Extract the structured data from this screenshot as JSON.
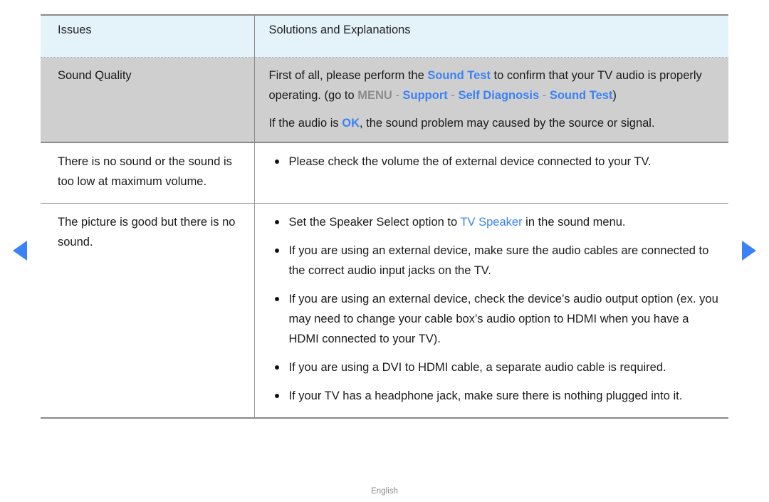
{
  "nav": {
    "prev_label": "previous page",
    "next_label": "next page"
  },
  "table": {
    "headers": {
      "issues": "Issues",
      "solutions": "Solutions and Explanations"
    },
    "rows": [
      {
        "issue": "Sound Quality",
        "highlighted": true,
        "paragraph_1": {
          "seg_1": "First of all, please perform the ",
          "kw_1": "Sound Test",
          "seg_2": " to confirm that your TV audio is properly operating. (go to ",
          "kw_menu": "MENU",
          "sep_1": " - ",
          "kw_support": "Support",
          "sep_2": " - ",
          "kw_selfdiag": "Self Diagnosis",
          "sep_3": " - ",
          "kw_soundtest": "Sound Test",
          "seg_end": ")"
        },
        "paragraph_2": {
          "seg_1": "If the audio is ",
          "kw_ok": "OK",
          "seg_2": ", the sound problem may caused by the source or signal."
        }
      },
      {
        "issue": "There is no sound or the sound is too low at maximum volume.",
        "highlighted": false,
        "bullets": [
          {
            "seg_1": "Please check the volume the of external device connected to your TV."
          }
        ]
      },
      {
        "issue": "The picture is good but there is no sound.",
        "highlighted": false,
        "bullets": [
          {
            "seg_1": "Set the Speaker Select option to ",
            "kw": "TV Speaker",
            "seg_2": " in the sound menu."
          },
          {
            "seg_1": "If you are using an external device, make sure the audio cables are connected to the correct audio input jacks on the TV."
          },
          {
            "seg_1": "If you are using an external device, check the device’s audio output option (ex. you may need to change your cable box’s audio option to HDMI when you have a HDMI connected to your TV)."
          },
          {
            "seg_1": "If you are using a DVI to HDMI cable, a separate audio cable is required."
          },
          {
            "seg_1": "If your TV has a headphone jack, make sure there is nothing plugged into it."
          }
        ]
      }
    ]
  },
  "footer": {
    "language": "English"
  },
  "colors": {
    "accent_blue": "#3b82f6",
    "header_bg": "#e4f3fa",
    "highlight_row_bg": "#cfcfcf",
    "muted_gray": "#8c8c8c"
  }
}
